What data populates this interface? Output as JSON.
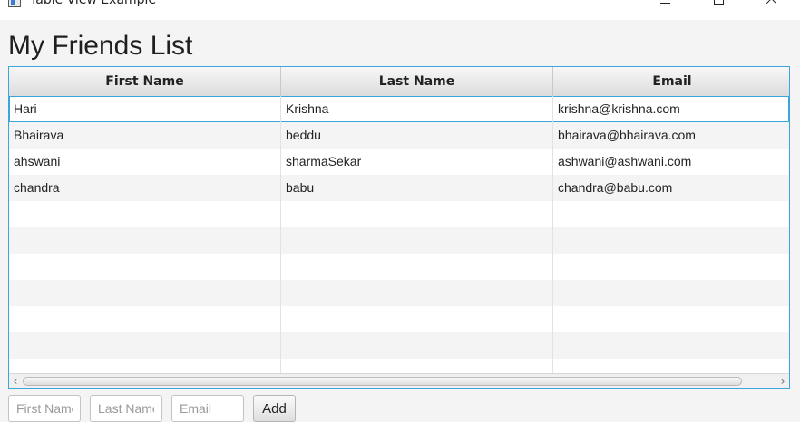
{
  "window": {
    "title": "Table View Example",
    "controls": {
      "minimize_icon": "minimize-icon",
      "maximize_icon": "maximize-icon",
      "close_icon": "close-icon"
    }
  },
  "heading": "My Friends List",
  "table": {
    "columns": [
      "First Name",
      "Last Name",
      "Email"
    ],
    "rows": [
      {
        "first": "Hari",
        "last": "Krishna",
        "email": "krishna@krishna.com"
      },
      {
        "first": "Bhairava",
        "last": "beddu",
        "email": "bhairava@bhairava.com"
      },
      {
        "first": "ahswani",
        "last": "sharmaSekar",
        "email": "ashwani@ashwani.com"
      },
      {
        "first": "chandra",
        "last": "babu",
        "email": "chandra@babu.com"
      }
    ],
    "selected_row": 0
  },
  "form": {
    "first_name_placeholder": "First Name",
    "last_name_placeholder": "Last Name",
    "email_placeholder": "Email",
    "add_label": "Add"
  },
  "colors": {
    "accent": "#3aa6dd"
  }
}
